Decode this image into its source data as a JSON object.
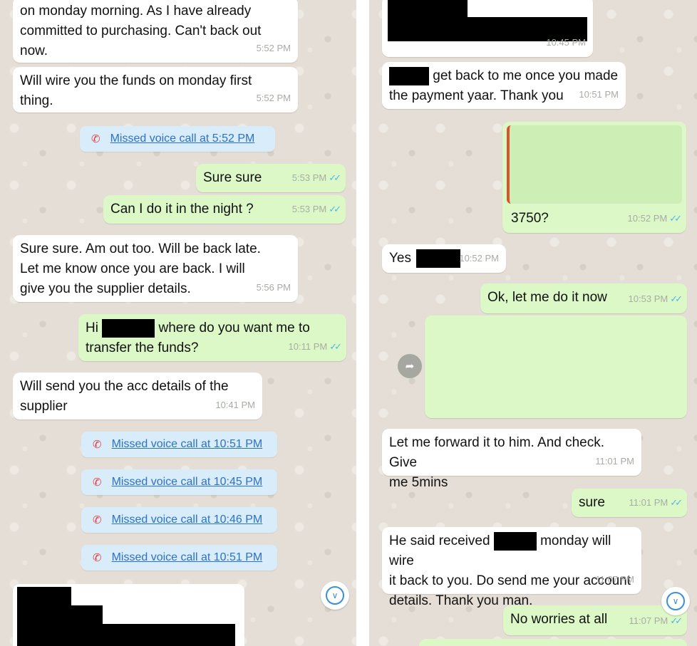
{
  "left": {
    "messages": [
      {
        "text": "on monday morning. As I have already\ncommitted to purchasing. Can't back out\nnow.",
        "time": "5:52 PM"
      },
      {
        "text": "Will wire you the funds on monday first\nthing.",
        "time": "5:52 PM"
      },
      {
        "text": "Sure sure",
        "time": "5:53 PM"
      },
      {
        "text": "Can I do it in the night ?",
        "time": "5:53 PM"
      },
      {
        "text": "Sure sure. Am out too. Will be back late.\nLet me know once you are back. I will\ngive you the supplier details.",
        "time": "5:56 PM"
      },
      {
        "pre": "Hi",
        "post": "where do you want me to",
        "line2": "transfer the funds?",
        "time": "10:11 PM"
      },
      {
        "text": "Will send you the acc details of the\nsupplier",
        "time": "10:41 PM"
      }
    ],
    "calls": [
      "Missed voice call at 5:52 PM",
      "Missed voice call at 10:51 PM",
      "Missed voice call at 10:45 PM",
      "Missed voice call at 10:46 PM",
      "Missed voice call at 10:51 PM"
    ]
  },
  "right": {
    "messages": [
      {
        "time": "10:45 PM"
      },
      {
        "post": "get back to me once you made",
        "line2": "the payment yaar. Thank you",
        "time": "10:51 PM"
      },
      {
        "text": "3750?",
        "time": "10:52 PM"
      },
      {
        "text": "Yes",
        "time": "10:52 PM"
      },
      {
        "text": "Ok, let me do it now",
        "time": "10:53 PM"
      },
      {
        "text": "Let me forward it to him. And check. Give\nme 5mins",
        "time": "11:01 PM"
      },
      {
        "text": "sure",
        "time": "11:01 PM"
      },
      {
        "pre": "He said received",
        "post": "monday will wire",
        "line2": "it back to you. Do send me your account\ndetails. Thank you man.",
        "time": "11:07 PM"
      },
      {
        "text": "No worries at all",
        "time": "11:07 PM"
      }
    ]
  },
  "icons": {
    "ticks": "✓✓",
    "phone": "missed-call-icon",
    "chevron": "chevron-down-icon",
    "forward": "forward-arrow-icon"
  },
  "colors": {
    "incoming": "#ffffff",
    "outgoing": "#dcf8c6",
    "ticks": "#4fb6ec",
    "call_link": "#2c72c7",
    "missed": "#e53935"
  }
}
